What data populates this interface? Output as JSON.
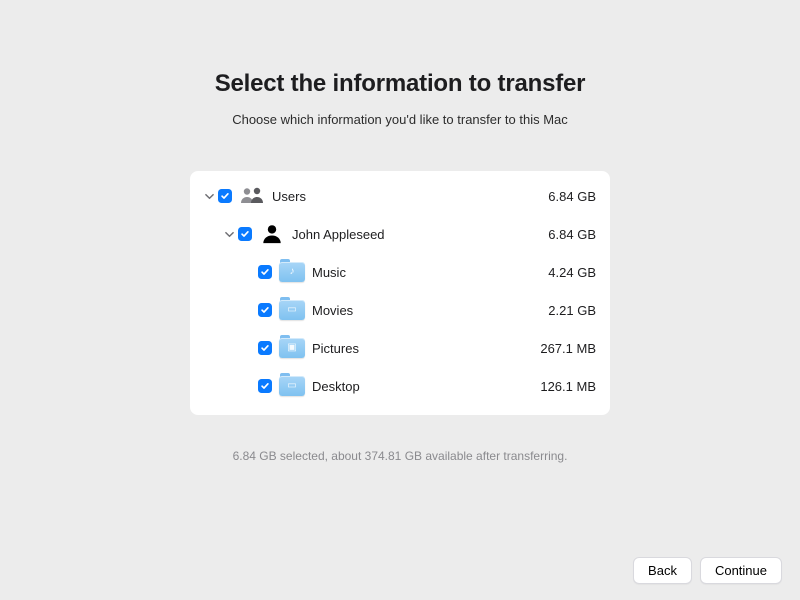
{
  "title": "Select the information to transfer",
  "subtitle": "Choose which information you'd like to transfer to this Mac",
  "tree": {
    "label": "Users",
    "size": "6.84 GB",
    "user": {
      "label": "John Appleseed",
      "size": "6.84 GB",
      "folders": [
        {
          "label": "Music",
          "size": "4.24 GB",
          "glyph": "♪"
        },
        {
          "label": "Movies",
          "size": "2.21 GB",
          "glyph": "▭"
        },
        {
          "label": "Pictures",
          "size": "267.1 MB",
          "glyph": "▣"
        },
        {
          "label": "Desktop",
          "size": "126.1 MB",
          "glyph": "▭"
        }
      ]
    }
  },
  "status": "6.84 GB selected, about 374.81 GB available after transferring.",
  "buttons": {
    "back": "Back",
    "continue": "Continue"
  }
}
